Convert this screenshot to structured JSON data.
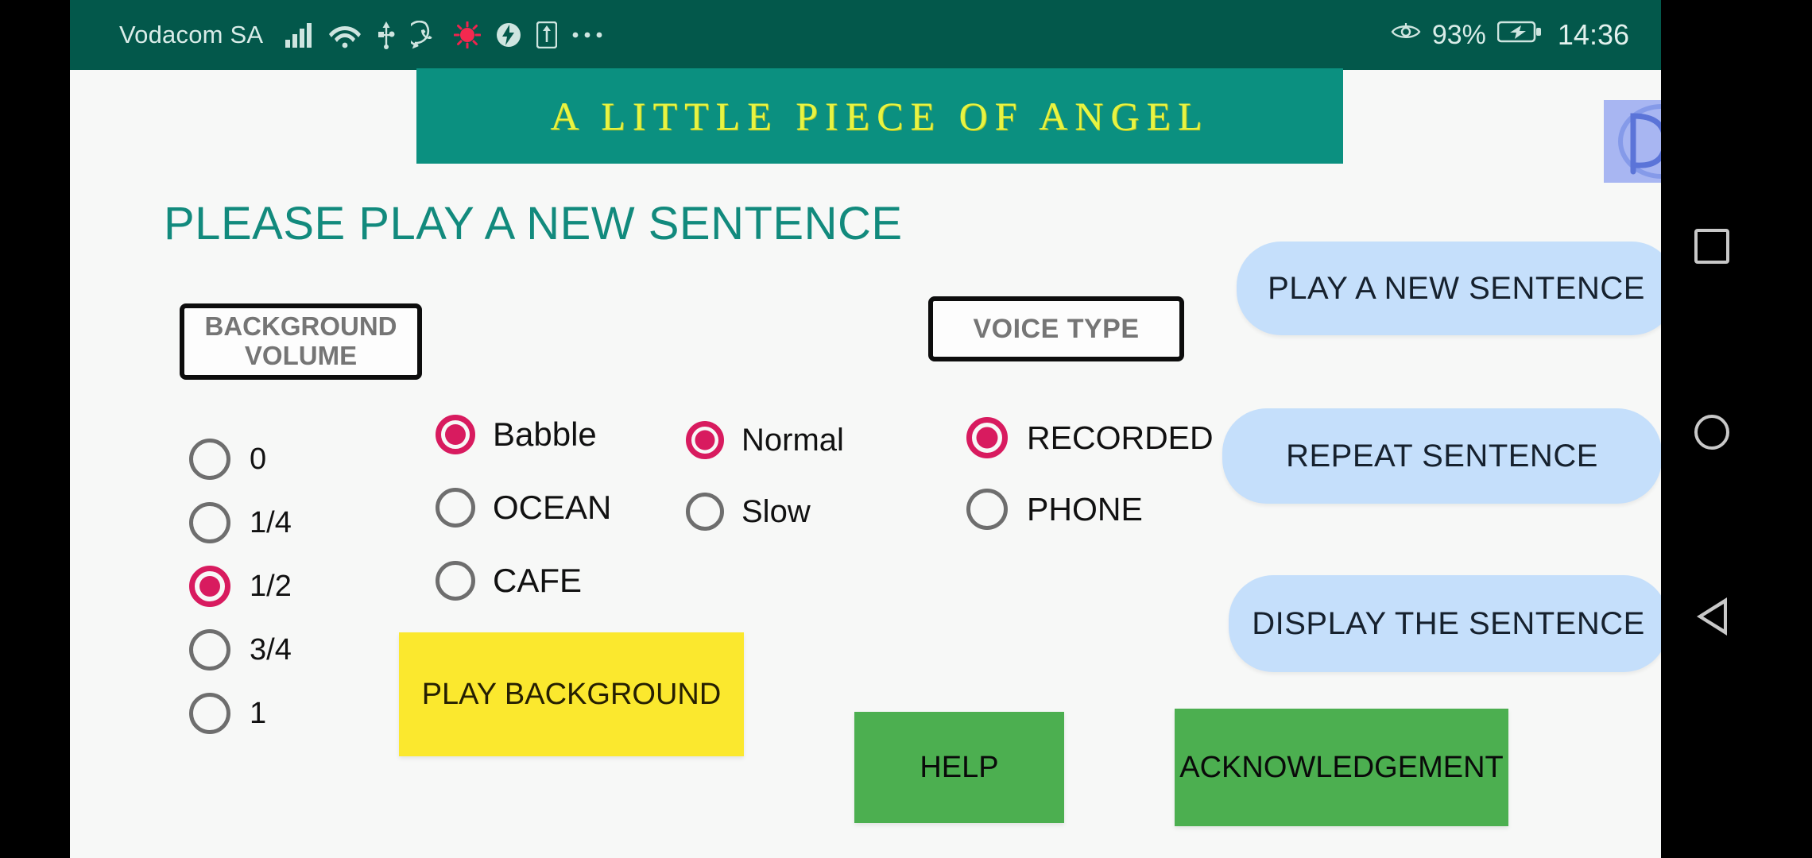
{
  "statusbar": {
    "carrier": "Vodacom SA",
    "battery_percent": "93%",
    "time": "14:36",
    "icons": [
      "signal-bars-icon",
      "wifi-icon",
      "usb-icon",
      "whatsapp-icon",
      "alarm-icon",
      "battery-saver-icon",
      "screenshot-icon",
      "more-icon"
    ],
    "right_icons": [
      "eye-comfort-icon",
      "battery-charging-icon"
    ]
  },
  "banner": {
    "title": "A LITTLE PIECE OF ANGEL"
  },
  "logo": {
    "alt": "PDK"
  },
  "heading": "PLEASE PLAY A NEW SENTENCE",
  "background_volume": {
    "label": "BACKGROUND\nVOLUME",
    "label_line1": "BACKGROUND",
    "label_line2": "VOLUME",
    "selected": "1/2",
    "options": [
      {
        "label": "0",
        "selected": false
      },
      {
        "label": "1/4",
        "selected": false
      },
      {
        "label": "1/2",
        "selected": true
      },
      {
        "label": "3/4",
        "selected": false
      },
      {
        "label": "1",
        "selected": false
      }
    ]
  },
  "noise_type": {
    "selected": "Babble",
    "options": [
      {
        "label": "Babble",
        "selected": true
      },
      {
        "label": "OCEAN",
        "selected": false
      },
      {
        "label": "CAFE",
        "selected": false
      }
    ]
  },
  "speed": {
    "selected": "Normal",
    "options": [
      {
        "label": "Normal",
        "selected": true
      },
      {
        "label": "Slow",
        "selected": false
      }
    ]
  },
  "voice_type": {
    "label": "VOICE TYPE",
    "selected": "RECORDED",
    "options": [
      {
        "label": "RECORDED",
        "selected": true
      },
      {
        "label": "PHONE",
        "selected": false
      }
    ]
  },
  "buttons": {
    "play_new_sentence": "PLAY A NEW SENTENCE",
    "repeat_sentence": "REPEAT SENTENCE",
    "display_the_sentence": "DISPLAY THE SENTENCE",
    "play_background": "PLAY BACKGROUND",
    "help": "HELP",
    "acknowledgement": "ACKNOWLEDGEMENT"
  },
  "navbar": {
    "recents": "recents-square-icon",
    "home": "home-circle-icon",
    "back": "back-triangle-icon"
  },
  "colors": {
    "statusbar_bg": "#03584b",
    "banner_bg": "#0b9080",
    "banner_text": "#e8f442",
    "heading_text": "#128a7d",
    "radio_accent": "#d81b5f",
    "pill_bg": "#c5dffb",
    "yellow_btn": "#fbe82e",
    "green_btn": "#4caf50",
    "page_bg": "#f7f8f7"
  }
}
